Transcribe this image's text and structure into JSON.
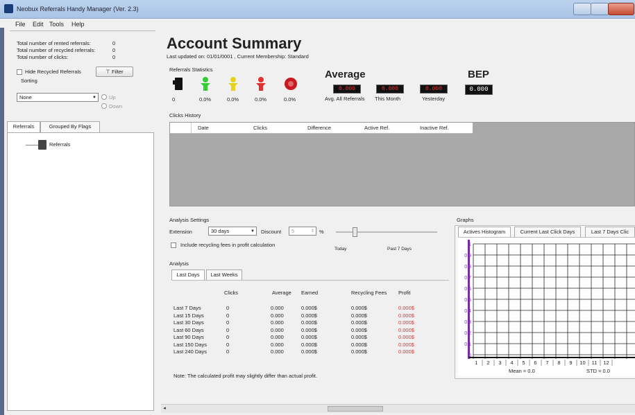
{
  "window": {
    "title": "Neobux Referrals Handy Manager (Ver. 2.3)"
  },
  "menu": [
    "File",
    "Edit",
    "Tools",
    "Help"
  ],
  "left": {
    "stats": [
      {
        "label": "Total number of rented referrals:",
        "value": "0"
      },
      {
        "label": "Total number of recycled referrals:",
        "value": "0"
      },
      {
        "label": "Total number of clicks:",
        "value": "0"
      }
    ],
    "hide_recycled_label": "Hide Recycled Referrals",
    "filter_label": "Filter",
    "sorting_label": "Sorting",
    "sorting_value": "None",
    "up_label": "Up",
    "down_label": "Down",
    "tabs": [
      "Referrals",
      "Grouped By Flags"
    ],
    "tree_node": "Referrals"
  },
  "summary": {
    "title": "Account Summary",
    "last_updated_label": "Last updated on:",
    "last_updated_value": "01/01/0001",
    "membership_label": ", Current Membership:",
    "membership_value": "Standard"
  },
  "ref_stats": {
    "label": "Referrals Statistics",
    "values": [
      "0",
      "0.0%",
      "0.0%",
      "0.0%",
      "0.0%"
    ],
    "icon_colors": [
      "#111111",
      "#33cc33",
      "#e6d21a",
      "#e03030",
      "#c8191e"
    ]
  },
  "average": {
    "title": "Average",
    "values": [
      {
        "value": "0.000",
        "label": "Avg. All Referrals"
      },
      {
        "value": "0.000",
        "label": "This Month"
      },
      {
        "value": "0.000",
        "label": "Yesterday"
      }
    ]
  },
  "bep": {
    "title": "BEP",
    "value": "0.000"
  },
  "clicks_history": {
    "label": "Clicks History",
    "columns": [
      "Date",
      "Clicks",
      "Difference",
      "Active Ref.",
      "Inactive Ref."
    ]
  },
  "analysis_settings": {
    "label": "Analysis Settings",
    "extension_label": "Extension",
    "extension_value": "30 days",
    "discount_label": "Discount",
    "discount_value": "5",
    "percent": "%",
    "include_fees_label": "Include recycling fees in profit calculation",
    "slider_left": "Today",
    "slider_right": "Past 7 Days"
  },
  "analysis": {
    "label": "Analysis",
    "tabs": [
      "Last Days",
      "Last Weeks"
    ],
    "columns": [
      "Clicks",
      "Average",
      "Earned",
      "Recycling Fees",
      "Profit"
    ],
    "rows": [
      {
        "period": "Last 7 Days",
        "clicks": "0",
        "average": "0.000",
        "earned": "0.000$",
        "fees": "0.000$",
        "profit": "0.000$"
      },
      {
        "period": "Last 15 Days",
        "clicks": "0",
        "average": "0.000",
        "earned": "0.000$",
        "fees": "0.000$",
        "profit": "0.000$"
      },
      {
        "period": "Last 30 Days",
        "clicks": "0",
        "average": "0.000",
        "earned": "0.000$",
        "fees": "0.000$",
        "profit": "0.000$"
      },
      {
        "period": "Last 60 Days",
        "clicks": "0",
        "average": "0.000",
        "earned": "0.000$",
        "fees": "0.000$",
        "profit": "0.000$"
      },
      {
        "period": "Last 90 Days",
        "clicks": "0",
        "average": "0.000",
        "earned": "0.000$",
        "fees": "0.000$",
        "profit": "0.000$"
      },
      {
        "period": "Last 150 Days",
        "clicks": "0",
        "average": "0.000",
        "earned": "0.000$",
        "fees": "0.000$",
        "profit": "0.000$"
      },
      {
        "period": "Last 240 Days",
        "clicks": "0",
        "average": "0.000",
        "earned": "0.000$",
        "fees": "0.000$",
        "profit": "0.000$"
      }
    ],
    "note": "Note: The calculated profit may slightly differ than actual profit."
  },
  "graphs": {
    "label": "Graphs",
    "tabs": [
      "Actives Histogram",
      "Current Last Click Days",
      "Last 7 Days Clic"
    ],
    "y_ticks": [
      "1",
      "0.9",
      "0.8",
      "0.7",
      "0.6",
      "0.5",
      "0.4",
      "0.3",
      "0.2",
      "0.1",
      "0"
    ],
    "x_ticks": [
      "1",
      "2",
      "3",
      "4",
      "5",
      "6",
      "7",
      "8",
      "9",
      "10",
      "11",
      "12"
    ],
    "mean": "Mean = 0.0",
    "std": "STD = 0.0"
  }
}
